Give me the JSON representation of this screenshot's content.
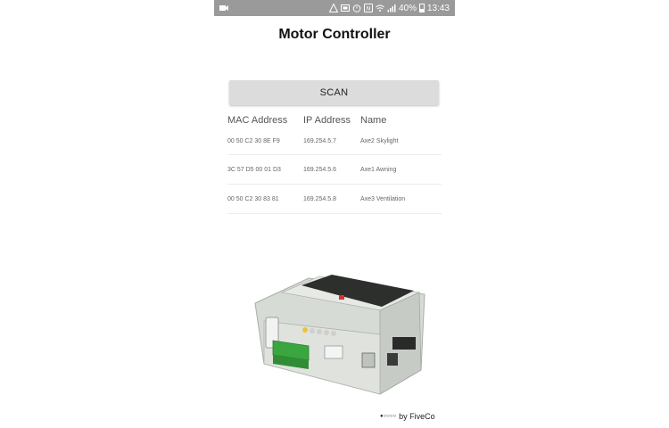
{
  "status_bar": {
    "battery_percent": "40%",
    "time": "13:43"
  },
  "app": {
    "title": "Motor Controller",
    "scan_label": "SCAN"
  },
  "table": {
    "headers": [
      "MAC Address",
      "IP Address",
      "Name"
    ],
    "rows": [
      {
        "mac": "00 50 C2 30 8E F9",
        "ip": "169.254.5.7",
        "name": "Axe2 Skylight"
      },
      {
        "mac": "3C 57 D5 00 01 D3",
        "ip": "169.254.5.6",
        "name": "Axe1 Awning"
      },
      {
        "mac": "00 50 C2 30 83 81",
        "ip": "169.254.5.8",
        "name": "Axe3 Ventilation"
      }
    ]
  },
  "product_image": {
    "logo_dots": "●○○○○",
    "logo_text": "by FiveCo"
  },
  "colors": {
    "status_bar_bg": "#9a9a9a",
    "button_bg": "#dcdcdc",
    "connector_green": "#3aa63f"
  },
  "icons": [
    "video-icon",
    "warning-icon",
    "screen-icon",
    "alarm-icon",
    "nfc-icon",
    "wifi-icon",
    "signal-icon",
    "battery-icon"
  ]
}
